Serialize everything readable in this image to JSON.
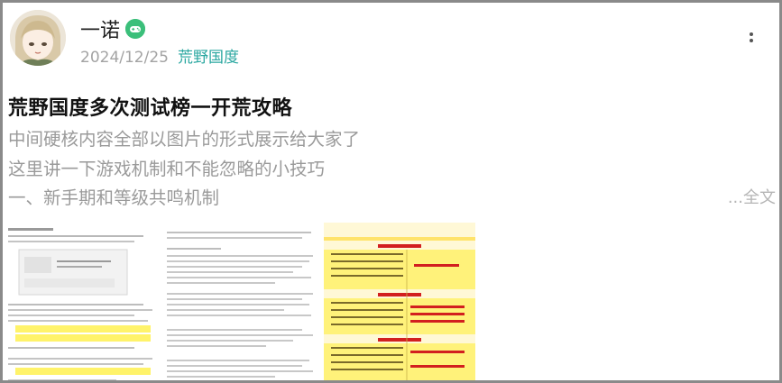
{
  "post": {
    "author": {
      "name": "一诺",
      "badge_icon": "gamepad-icon"
    },
    "date": "2024/12/25",
    "tag": "荒野国度",
    "more_icon": "more-vertical-icon",
    "title": "荒野国度多次测试榜一开荒攻略",
    "excerpt_lines": [
      "中间硬核内容全部以图片的形式展示给大家了",
      "这里讲一下游戏机制和不能忽略的小技巧",
      "一、新手期和等级共鸣机制"
    ],
    "expand_label": "...全文"
  },
  "colors": {
    "tag": "#2aa7a0",
    "badge": "#3bbf7a",
    "highlight_yellow": "#fff200",
    "table_red": "#d21f1f"
  }
}
